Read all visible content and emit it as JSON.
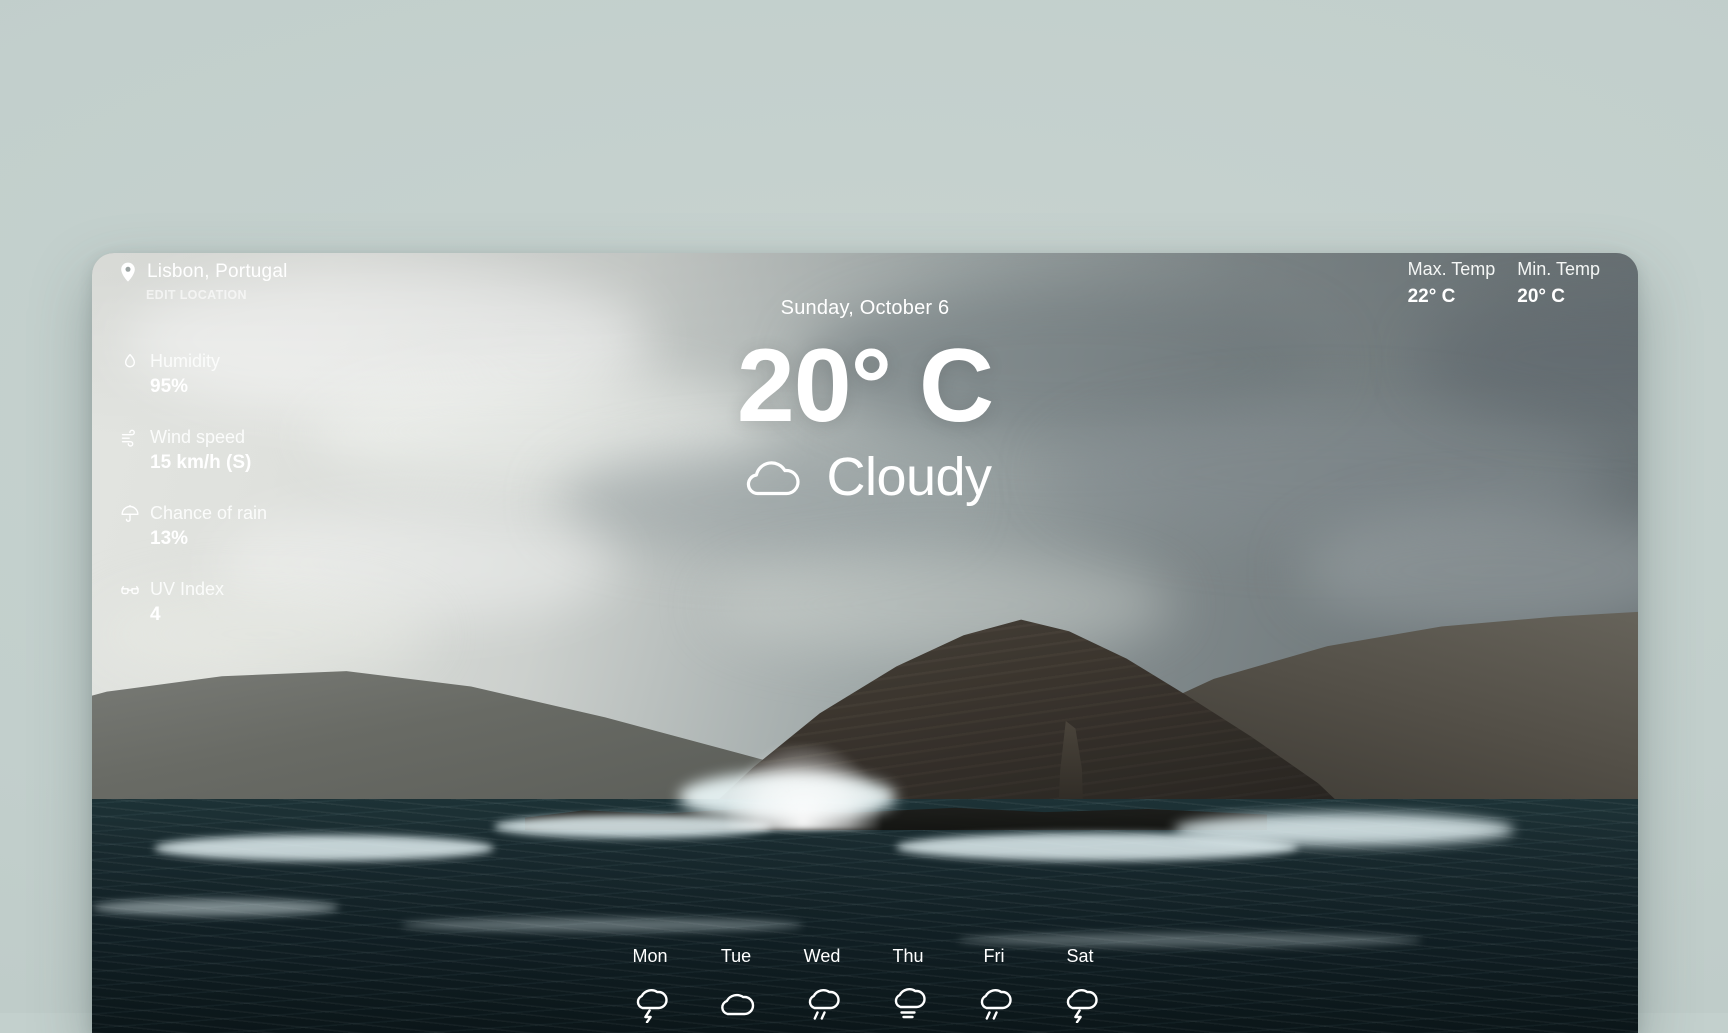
{
  "theme": {
    "page_background": "#c3d0cd",
    "text_primary": "#ffffff",
    "text_muted": "rgba(255,255,255,0.62)"
  },
  "location": {
    "icon": "map-pin-icon",
    "name": "Lisbon, Portugal",
    "edit_label": "EDIT LOCATION"
  },
  "stats": [
    {
      "icon": "droplet-icon",
      "label": "Humidity",
      "value": "95%"
    },
    {
      "icon": "wind-icon",
      "label": "Wind speed",
      "value": "15 km/h (S)"
    },
    {
      "icon": "umbrella-icon",
      "label": "Chance of rain",
      "value": "13%"
    },
    {
      "icon": "sunglasses-icon",
      "label": "UV Index",
      "value": "4"
    }
  ],
  "temps": {
    "max": {
      "label": "Max. Temp",
      "value": "22° C"
    },
    "min": {
      "label": "Min. Temp",
      "value": "20° C"
    }
  },
  "current": {
    "date": "Sunday, October 6",
    "temperature": "20° C",
    "condition": "Cloudy",
    "condition_icon": "cloud-icon"
  },
  "forecast": [
    {
      "day": "Mon",
      "icon": "cloud-lightning-icon"
    },
    {
      "day": "Tue",
      "icon": "cloud-icon"
    },
    {
      "day": "Wed",
      "icon": "cloud-rain-icon"
    },
    {
      "day": "Thu",
      "icon": "cloud-fog-icon"
    },
    {
      "day": "Fri",
      "icon": "cloud-rain-icon"
    },
    {
      "day": "Sat",
      "icon": "cloud-lightning-icon"
    }
  ]
}
